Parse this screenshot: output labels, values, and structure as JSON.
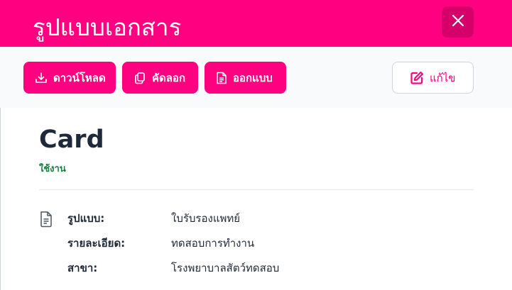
{
  "header": {
    "title": "รูปแบบเอกสาร"
  },
  "toolbar": {
    "download_label": "ดาวน์โหลด",
    "copy_label": "คัดลอก",
    "design_label": "ออกแบบ",
    "edit_label": "แก้ไข"
  },
  "card": {
    "title": "Card",
    "status": "ใช้งาน",
    "rows": [
      {
        "label": "รูปแบบ:",
        "value": "ใบรับรองแพทย์"
      },
      {
        "label": "รายละเอียด:",
        "value": "ทดสอบการทำงาน"
      },
      {
        "label": "สาขา:",
        "value": "โรงพยาบาลสัตว์ทดสอบ"
      }
    ]
  },
  "icons": {
    "close": "close-icon",
    "download": "download-icon",
    "copy": "copy-icon",
    "design": "document-icon",
    "edit": "edit-icon",
    "details": "document-icon"
  },
  "colors": {
    "brand": "#ff0080",
    "brand_dark": "#d6006b",
    "status_active": "#15803d",
    "toolbar_bg": "#f8fafc",
    "text": "#1f2937"
  }
}
